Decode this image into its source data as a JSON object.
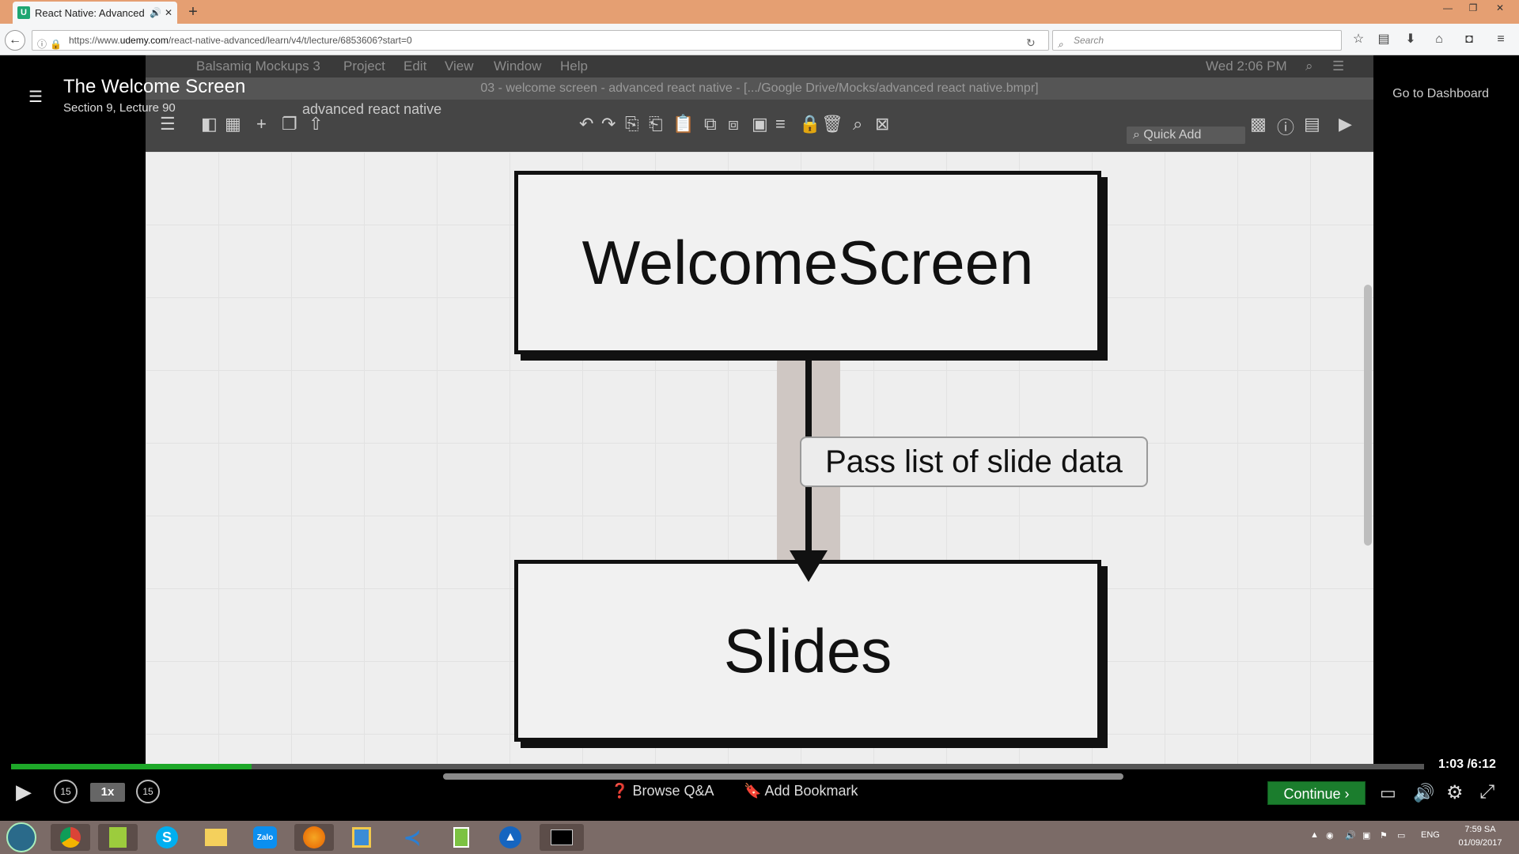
{
  "browser": {
    "tab_title": "React Native: Advanced (",
    "tab_favicon": "U",
    "url_prefix": "https://www.",
    "url_host": "udemy.com",
    "url_path": "/react-native-advanced/learn/v4/t/lecture/6853606?start=0",
    "search_placeholder": "Search"
  },
  "lecture": {
    "title": "The Welcome Screen",
    "subtitle": "Section 9, Lecture 90",
    "go_to_dashboard": "Go to Dashboard"
  },
  "video": {
    "mac_menu": [
      "Balsamiq Mockups 3",
      "Project",
      "Edit",
      "View",
      "Window",
      "Help"
    ],
    "mac_clock": "Wed 2:06 PM",
    "doc_title": "03 - welcome screen - advanced react native - [.../Google Drive/Mocks/advanced react native.bmpr]",
    "project_name": "advanced react native",
    "quick_add": "Quick Add",
    "diagram": {
      "top_box": "WelcomeScreen",
      "bottom_box": "Slides",
      "connector_label": "Pass list of slide data"
    }
  },
  "controls": {
    "progress_fraction": 0.1703,
    "elapsed": "1:03",
    "total": "/6:12",
    "speed": "1x",
    "skip_back": "15",
    "skip_forward": "15",
    "browse_qa": "Browse Q&A",
    "add_bookmark": "Add Bookmark",
    "continue": "Continue"
  },
  "taskbar": {
    "apps": [
      "chrome",
      "notepad",
      "skype",
      "explorer",
      "zalo",
      "firefox",
      "files",
      "vscode",
      "phone",
      "app",
      "cmd"
    ],
    "zalo_label": "Zalo",
    "lang": "ENG",
    "time": "7:59 SA",
    "date": "01/09/2017"
  },
  "colors": {
    "progress": "#1ea829",
    "continue_bg": "#1b7d2d",
    "titlebar": "#e59f72"
  }
}
